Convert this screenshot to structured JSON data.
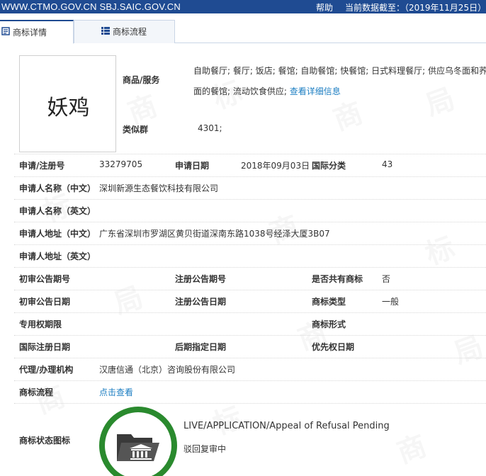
{
  "topbar": {
    "site": "WWW.CTMO.GOV.CN SBJ.SAIC.GOV.CN",
    "help": "帮助",
    "date_text": "当前数据截至：（2019年11月25日）"
  },
  "tabs": [
    {
      "label": "商标详情",
      "active": true
    },
    {
      "label": "商标流程",
      "active": false
    }
  ],
  "mark": {
    "text": "妖鸡"
  },
  "goods": {
    "label": "商品/服务",
    "line1": "自助餐厅; 餐厅; 饭店; 餐馆; 自助餐馆; 快餐馆; 日式料理餐厅; 供应乌冬面和荞麦",
    "line2": "面的餐馆; 流动饮食供应;",
    "more_link": "查看详细信息"
  },
  "similar_group": {
    "label": "类似群",
    "value": "4301;"
  },
  "fields": {
    "reg_no": {
      "label": "申请/注册号",
      "value": "33279705"
    },
    "app_date": {
      "label": "申请日期",
      "value": "2018年09月03日"
    },
    "intl_class": {
      "label": "国际分类",
      "value": "43"
    },
    "applicant_cn": {
      "label": "申请人名称（中文）",
      "value": "深圳新源生态餐饮科技有限公司"
    },
    "applicant_en": {
      "label": "申请人名称（英文）",
      "value": ""
    },
    "address_cn": {
      "label": "申请人地址（中文）",
      "value": "广东省深圳市罗湖区黄贝街道深南东路1038号经泽大厦3B07"
    },
    "address_en": {
      "label": "申请人地址（英文）",
      "value": ""
    },
    "prelim_no": {
      "label": "初审公告期号",
      "value": ""
    },
    "reg_pub_no": {
      "label": "注册公告期号",
      "value": ""
    },
    "shared": {
      "label": "是否共有商标",
      "value": "否"
    },
    "prelim_date": {
      "label": "初审公告日期",
      "value": ""
    },
    "reg_pub_date": {
      "label": "注册公告日期",
      "value": ""
    },
    "mark_type": {
      "label": "商标类型",
      "value": "一般"
    },
    "exclusive_period": {
      "label": "专用权期限",
      "value": ""
    },
    "mark_form": {
      "label": "商标形式",
      "value": ""
    },
    "intl_reg_date": {
      "label": "国际注册日期",
      "value": ""
    },
    "later_date": {
      "label": "后期指定日期",
      "value": ""
    },
    "priority_date": {
      "label": "优先权日期",
      "value": ""
    },
    "agent": {
      "label": "代理/办理机构",
      "value": "汉唐信通（北京）咨询股份有限公司"
    },
    "flow": {
      "label": "商标流程",
      "value": "点击查看"
    },
    "status_icon": {
      "label": "商标状态图标",
      "status_en": "LIVE/APPLICATION/Appeal of Refusal Pending",
      "status_cn": "驳回复审中"
    }
  },
  "colors": {
    "topbar": "#1f4b92",
    "link": "#1c7ec2",
    "status_ring": "#2a8a2e"
  },
  "watermark_text": [
    "商",
    "标",
    "局"
  ]
}
